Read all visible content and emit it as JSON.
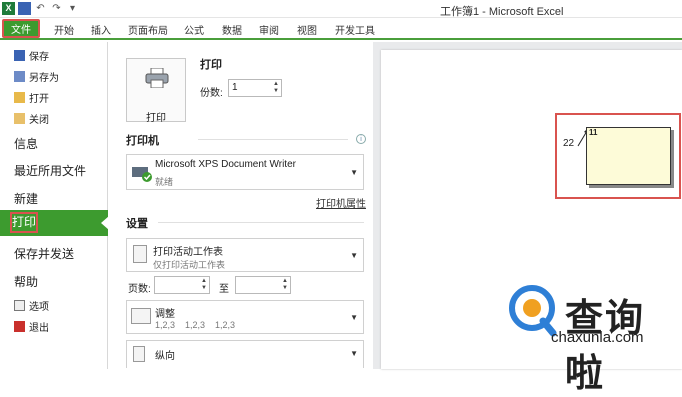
{
  "window": {
    "title": "工作簿1 - Microsoft Excel"
  },
  "ribbon": {
    "tabs": [
      {
        "label": "文件"
      },
      {
        "label": "开始"
      },
      {
        "label": "插入"
      },
      {
        "label": "页面布局"
      },
      {
        "label": "公式"
      },
      {
        "label": "数据"
      },
      {
        "label": "审阅"
      },
      {
        "label": "视图"
      },
      {
        "label": "开发工具"
      }
    ]
  },
  "leftnav": {
    "small_top": [
      {
        "label": "保存",
        "icon": "save-icon"
      },
      {
        "label": "另存为",
        "icon": "save-as-icon"
      },
      {
        "label": "打开",
        "icon": "folder-open-icon"
      },
      {
        "label": "关闭",
        "icon": "close-file-icon"
      }
    ],
    "big": [
      {
        "label": "信息"
      },
      {
        "label": "最近所用文件"
      },
      {
        "label": "新建"
      },
      {
        "label": "打印"
      },
      {
        "label": "保存并发送"
      },
      {
        "label": "帮助"
      }
    ],
    "small_bottom": [
      {
        "label": "选项",
        "icon": "options-icon"
      },
      {
        "label": "退出",
        "icon": "exit-icon"
      }
    ]
  },
  "print": {
    "button_label": "打印",
    "section_title": "打印",
    "copies_label": "份数:",
    "copies_value": "1"
  },
  "printer": {
    "heading": "打印机",
    "name": "Microsoft XPS Document Writer",
    "status": "就绪",
    "properties_link": "打印机属性"
  },
  "settings": {
    "heading": "设置",
    "what_to_print": {
      "title": "打印活动工作表",
      "subtitle": "仅打印活动工作表"
    },
    "pages_label": "页数:",
    "pages_to_label": "至",
    "collation": {
      "title": "调整",
      "subtitle": "1,2,3    1,2,3    1,2,3"
    },
    "orientation": {
      "title": "纵向"
    }
  },
  "preview": {
    "cell_value": "22",
    "comment_number": "11"
  },
  "watermark": {
    "cn": "查询啦",
    "en": "chaxunla.com"
  },
  "colors": {
    "accent_green": "#3d9b2f",
    "highlight_red": "#d9534f",
    "comment_fill": "#fdfbd8"
  }
}
